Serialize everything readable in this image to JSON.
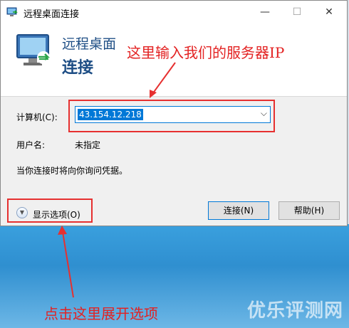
{
  "window": {
    "title": "远程桌面连接",
    "header_line1": "远程桌面",
    "header_line2": "连接"
  },
  "form": {
    "computer_label": "计算机(C):",
    "computer_value": "43.154.12.218",
    "user_label": "用户名:",
    "user_value": "未指定",
    "info_text": "当你连接时将向你询问凭据。"
  },
  "buttons": {
    "connect_label": "连接(N)",
    "help_label": "帮助(H)",
    "options_label": "显示选项(O)"
  },
  "annotations": {
    "top_note": "这里输入我们的服务器IP",
    "bottom_note": "点击这里展开选项",
    "watermark": "优乐评测网",
    "color": "#e63030"
  },
  "icons": [
    "remote-desktop-icon",
    "remote-desktop-logo-icon",
    "minimize-icon",
    "maximize-icon",
    "close-icon",
    "chevron-down-icon",
    "expand-options-icon"
  ]
}
